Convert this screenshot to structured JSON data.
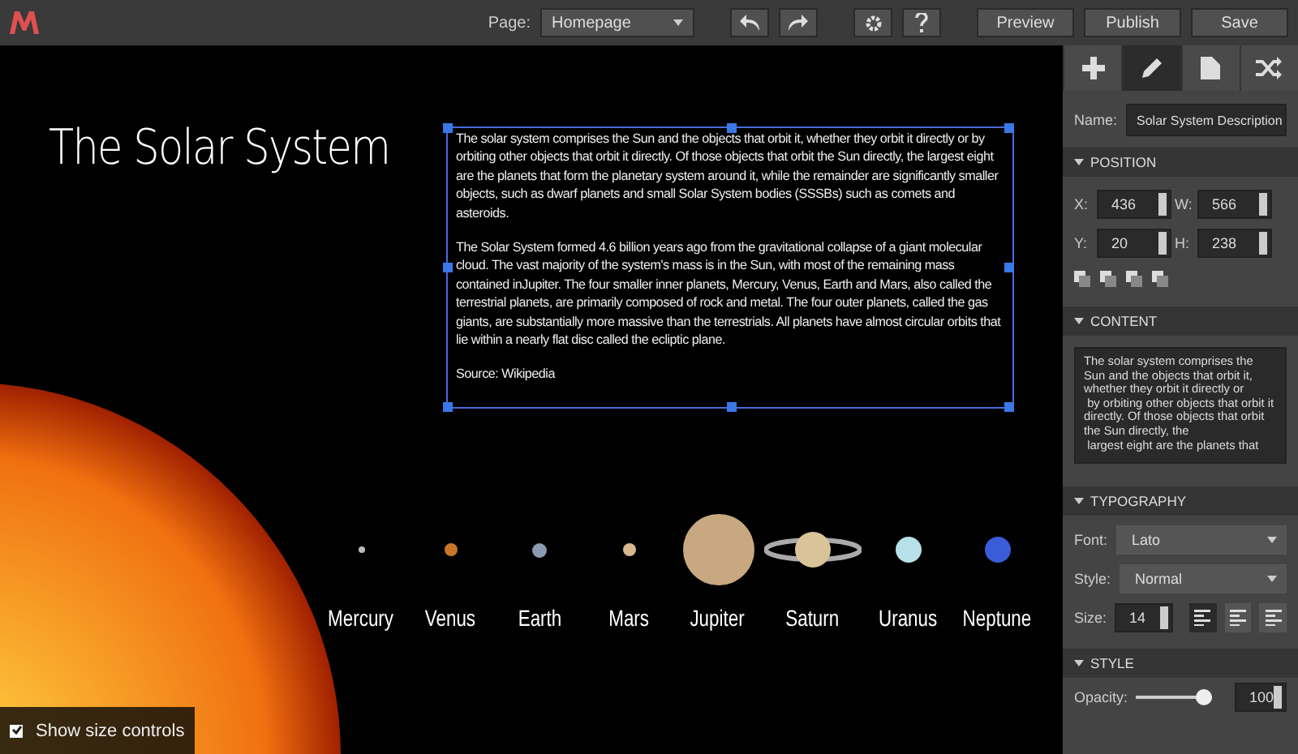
{
  "toolbar": {
    "page_label": "Page:",
    "page_value": "Homepage",
    "buttons": [
      "Preview",
      "Publish",
      "Save"
    ]
  },
  "sidebar_tabs": [
    {
      "selected": false
    },
    {
      "selected": true
    },
    {
      "selected": false
    },
    {
      "selected": false
    }
  ],
  "canvas": {
    "title": "The Solar System",
    "paragraphs": [
      "The solar system comprises the Sun and the objects that orbit it, whether they orbit it directly or by orbiting other objects that orbit it directly. Of those objects that orbit the Sun directly, the largest eight are the planets that form the planetary system around it, while the remainder are significantly smaller objects, such as dwarf planets and small Solar System bodies (SSSBs) such as comets and asteroids.",
      "The Solar System formed 4.6 billion years ago from the gravitational collapse of a giant molecular cloud. The vast majority of the system's mass is in the Sun, with most of the remaining mass contained inJupiter. The four smaller inner planets, Mercury, Venus, Earth and Mars, also called the terrestrial planets, are primarily composed of rock and metal. The four outer planets, called the gas giants, are substantially more massive than the terrestrials. All planets have almost circular orbits that lie within a nearly flat disc called the ecliptic plane.",
      "Source: Wikipedia"
    ],
    "planets": [
      "Mercury",
      "Venus",
      "Earth",
      "Mars",
      "Jupiter",
      "Saturn",
      "Uranus",
      "Neptune"
    ],
    "show_size_controls": {
      "label": "Show size controls",
      "checked": true
    }
  },
  "name_field": {
    "label": "Name:",
    "value": "Solar System Description"
  },
  "position": {
    "title": "POSITION",
    "fields": [
      {
        "label": "X:",
        "value": "436"
      },
      {
        "label": "W:",
        "value": "566"
      },
      {
        "label": "Y:",
        "value": "20"
      },
      {
        "label": "H:",
        "value": "238"
      }
    ]
  },
  "content": {
    "title": "CONTENT",
    "text": "The solar system comprises the Sun and the objects that orbit it, whether they orbit it directly or\n by orbiting other objects that orbit it directly. Of those objects that orbit the Sun directly, the\n largest eight are the planets that"
  },
  "typography": {
    "title": "TYPOGRAPHY",
    "font_label": "Font:",
    "font": "Lato",
    "style_label": "Style:",
    "style": "Normal",
    "size_label": "Size:",
    "size": "14",
    "align": [
      {
        "selected": true
      },
      {
        "selected": false
      },
      {
        "selected": false
      }
    ]
  },
  "style": {
    "title": "STYLE",
    "opacity_label": "Opacity:",
    "level": 1,
    "opacity": "100"
  }
}
